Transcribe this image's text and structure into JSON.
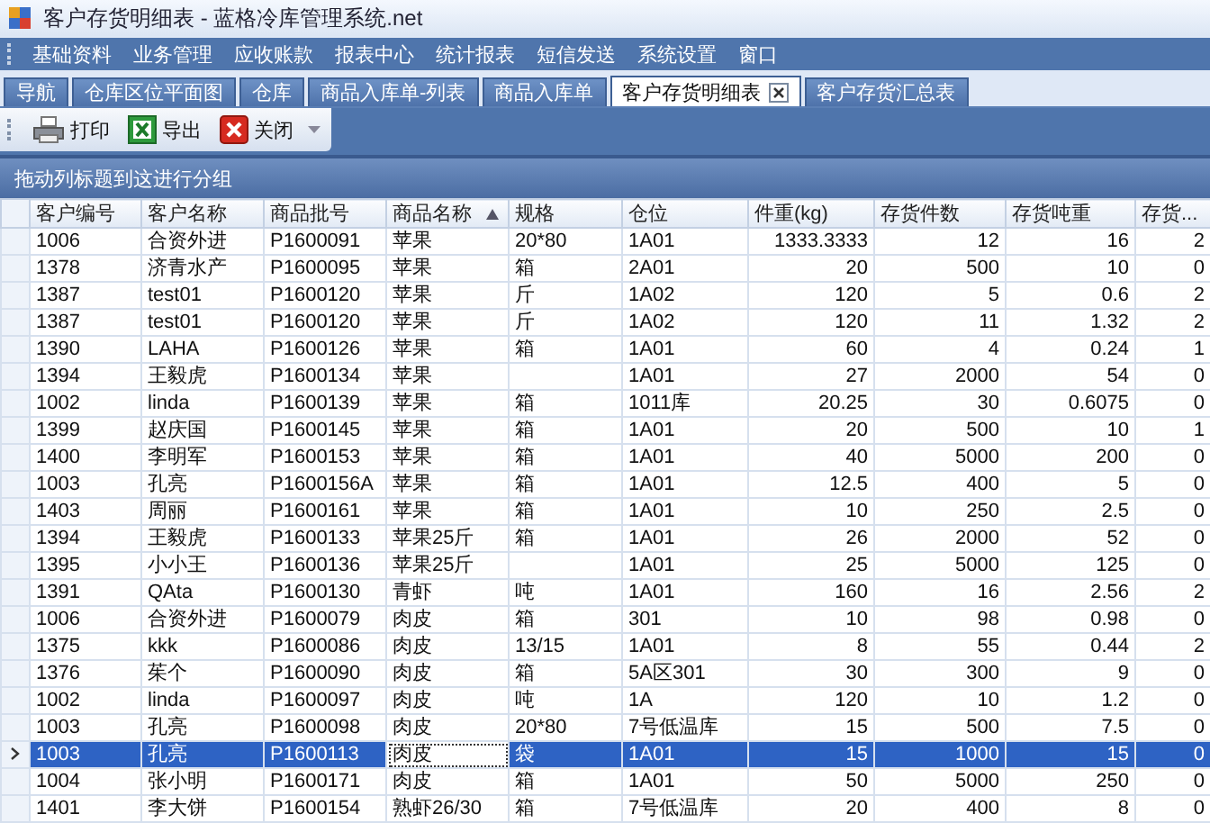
{
  "window": {
    "title": "客户存货明细表 - 蓝格冷库管理系统.net"
  },
  "menu": [
    "基础资料",
    "业务管理",
    "应收账款",
    "报表中心",
    "统计报表",
    "短信发送",
    "系统设置",
    "窗口"
  ],
  "tabs": [
    {
      "label": "导航",
      "selected": false,
      "closable": false
    },
    {
      "label": "仓库区位平面图",
      "selected": false,
      "closable": false
    },
    {
      "label": "仓库",
      "selected": false,
      "closable": false
    },
    {
      "label": "商品入库单-列表",
      "selected": false,
      "closable": false
    },
    {
      "label": "商品入库单",
      "selected": false,
      "closable": false
    },
    {
      "label": "客户存货明细表",
      "selected": true,
      "closable": true
    },
    {
      "label": "客户存货汇总表",
      "selected": false,
      "closable": false
    }
  ],
  "toolbar": [
    {
      "label": "打印"
    },
    {
      "label": "导出"
    },
    {
      "label": "关闭"
    }
  ],
  "group_panel": {
    "hint": "拖动列标题到这进行分组"
  },
  "table": {
    "columns": [
      {
        "label": "客户编号",
        "kind": "text",
        "sorted_ascending": false,
        "focused": false
      },
      {
        "label": "客户名称",
        "kind": "text",
        "sorted_ascending": false,
        "focused": false
      },
      {
        "label": "商品批号",
        "kind": "text",
        "sorted_ascending": false,
        "focused": false
      },
      {
        "label": "商品名称",
        "kind": "text",
        "sorted_ascending": true,
        "focused": true
      },
      {
        "label": "规格",
        "kind": "text",
        "sorted_ascending": false,
        "focused": false
      },
      {
        "label": "仓位",
        "kind": "text",
        "sorted_ascending": false,
        "focused": false
      },
      {
        "label": "件重(kg)",
        "kind": "number",
        "sorted_ascending": false,
        "focused": false
      },
      {
        "label": "存货件数",
        "kind": "number",
        "sorted_ascending": false,
        "focused": false
      },
      {
        "label": "存货吨重",
        "kind": "number",
        "sorted_ascending": false,
        "focused": false
      },
      {
        "label": "存货...",
        "kind": "number",
        "sorted_ascending": false,
        "focused": false
      }
    ],
    "rows": [
      {
        "selected": false,
        "cells": [
          "1006",
          "合资外进",
          "P1600091",
          "苹果",
          "20*80",
          "1A01",
          "1333.3333",
          "12",
          "16",
          "2"
        ]
      },
      {
        "selected": false,
        "cells": [
          "1378",
          "济青水产",
          "P1600095",
          "苹果",
          "箱",
          "2A01",
          "20",
          "500",
          "10",
          "0"
        ]
      },
      {
        "selected": false,
        "cells": [
          "1387",
          "test01",
          "P1600120",
          "苹果",
          "斤",
          "1A02",
          "120",
          "5",
          "0.6",
          "2"
        ]
      },
      {
        "selected": false,
        "cells": [
          "1387",
          "test01",
          "P1600120",
          "苹果",
          "斤",
          "1A02",
          "120",
          "11",
          "1.32",
          "2"
        ]
      },
      {
        "selected": false,
        "cells": [
          "1390",
          "LAHA",
          "P1600126",
          "苹果",
          "箱",
          "1A01",
          "60",
          "4",
          "0.24",
          "1"
        ]
      },
      {
        "selected": false,
        "cells": [
          "1394",
          "王毅虎",
          "P1600134",
          "苹果",
          null,
          "1A01",
          "27",
          "2000",
          "54",
          "0"
        ]
      },
      {
        "selected": false,
        "cells": [
          "1002",
          "linda",
          "P1600139",
          "苹果",
          "箱",
          "1011库",
          "20.25",
          "30",
          "0.6075",
          "0"
        ]
      },
      {
        "selected": false,
        "cells": [
          "1399",
          "赵庆国",
          "P1600145",
          "苹果",
          "箱",
          "1A01",
          "20",
          "500",
          "10",
          "1"
        ]
      },
      {
        "selected": false,
        "cells": [
          "1400",
          "李明军",
          "P1600153",
          "苹果",
          "箱",
          "1A01",
          "40",
          "5000",
          "200",
          "0"
        ]
      },
      {
        "selected": false,
        "cells": [
          "1003",
          "孔亮",
          "P1600156A",
          "苹果",
          "箱",
          "1A01",
          "12.5",
          "400",
          "5",
          "0"
        ]
      },
      {
        "selected": false,
        "cells": [
          "1403",
          "周丽",
          "P1600161",
          "苹果",
          "箱",
          "1A01",
          "10",
          "250",
          "2.5",
          "0"
        ]
      },
      {
        "selected": false,
        "cells": [
          "1394",
          "王毅虎",
          "P1600133",
          "苹果25斤",
          "箱",
          "1A01",
          "26",
          "2000",
          "52",
          "0"
        ]
      },
      {
        "selected": false,
        "cells": [
          "1395",
          "小小王",
          "P1600136",
          "苹果25斤",
          null,
          "1A01",
          "25",
          "5000",
          "125",
          "0"
        ]
      },
      {
        "selected": false,
        "cells": [
          "1391",
          "QAta",
          "P1600130",
          "青虾",
          "吨",
          "1A01",
          "160",
          "16",
          "2.56",
          "2"
        ]
      },
      {
        "selected": false,
        "cells": [
          "1006",
          "合资外进",
          "P1600079",
          "肉皮",
          "箱",
          "301",
          "10",
          "98",
          "0.98",
          "0"
        ]
      },
      {
        "selected": false,
        "cells": [
          "1375",
          "kkk",
          "P1600086",
          "肉皮",
          "13/15",
          "1A01",
          "8",
          "55",
          "0.44",
          "2"
        ]
      },
      {
        "selected": false,
        "cells": [
          "1376",
          "茱个",
          "P1600090",
          "肉皮",
          "箱",
          "5A区301",
          "30",
          "300",
          "9",
          "0"
        ]
      },
      {
        "selected": false,
        "cells": [
          "1002",
          "linda",
          "P1600097",
          "肉皮",
          "吨",
          "1A",
          "120",
          "10",
          "1.2",
          "0"
        ]
      },
      {
        "selected": false,
        "cells": [
          "1003",
          "孔亮",
          "P1600098",
          "肉皮",
          "20*80",
          "7号低温库",
          "15",
          "500",
          "7.5",
          "0"
        ]
      },
      {
        "selected": true,
        "cells": [
          "1003",
          "孔亮",
          "P1600113",
          "肉皮",
          "袋",
          "1A01",
          "15",
          "1000",
          "15",
          "0"
        ]
      },
      {
        "selected": false,
        "cells": [
          "1004",
          "张小明",
          "P1600171",
          "肉皮",
          "箱",
          "1A01",
          "50",
          "5000",
          "250",
          "0"
        ]
      },
      {
        "selected": false,
        "cells": [
          "1401",
          "李大饼",
          "P1600154",
          "熟虾26/30",
          "箱",
          "7号低温库",
          "20",
          "400",
          "8",
          "0"
        ]
      }
    ]
  }
}
